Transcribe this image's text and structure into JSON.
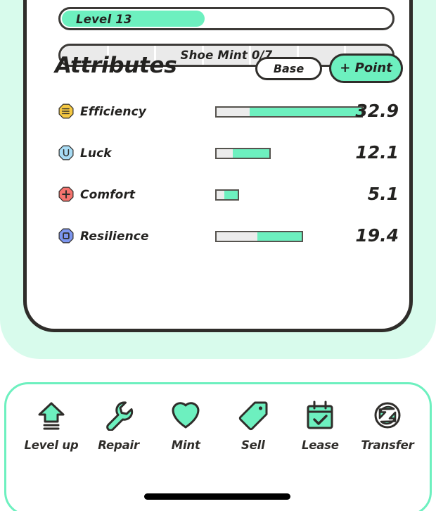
{
  "theme": {
    "mint": "#6df0bf",
    "mint_bg": "#d8fbec",
    "ink": "#2f2d2a",
    "track_gray": "#ececec"
  },
  "level_bar": {
    "label": "Level 13",
    "fill_percent": 43
  },
  "mint_bar": {
    "label": "Shoe Mint 0/7",
    "segments": 7,
    "filled": 0,
    "total": 7
  },
  "attributes_section": {
    "title": "Attributes",
    "base_button": "Base",
    "point_button": "+ Point",
    "rows": [
      {
        "icon": "efficiency-icon",
        "icon_color": "#f5c842",
        "name": "Efficiency",
        "value": "32.9",
        "track_width": 210,
        "fill_percent": 77
      },
      {
        "icon": "luck-icon",
        "icon_color": "#a8dcf5",
        "name": "Luck",
        "value": "12.1",
        "track_width": 79,
        "fill_percent": 70
      },
      {
        "icon": "comfort-icon",
        "icon_color": "#f5736e",
        "name": "Comfort",
        "value": "5.1",
        "track_width": 34,
        "fill_percent": 62
      },
      {
        "icon": "resilience-icon",
        "icon_color": "#7d96ef",
        "name": "Resilience",
        "value": "19.4",
        "track_width": 125,
        "fill_percent": 52
      }
    ]
  },
  "action_bar": {
    "items": [
      {
        "icon": "level-up-icon",
        "label": "Level up"
      },
      {
        "icon": "wrench-icon",
        "label": "Repair"
      },
      {
        "icon": "heart-icon",
        "label": "Mint"
      },
      {
        "icon": "tag-icon",
        "label": "Sell"
      },
      {
        "icon": "calendar-check-icon",
        "label": "Lease"
      },
      {
        "icon": "transfer-icon",
        "label": "Transfer"
      }
    ]
  }
}
